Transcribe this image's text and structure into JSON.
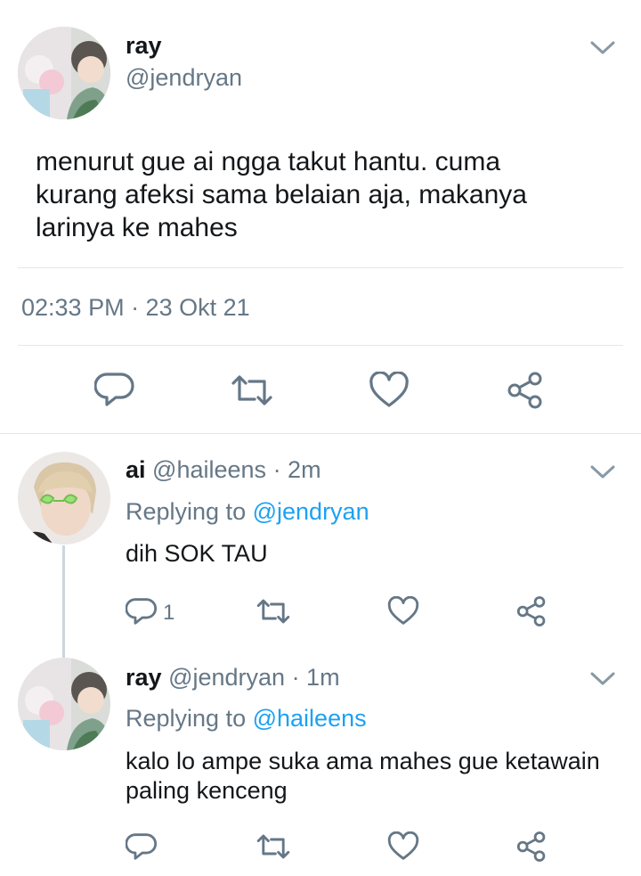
{
  "main_tweet": {
    "name": "ray",
    "handle": "@jendryan",
    "text_lines": [
      "menurut gue ai ngga takut hantu. cuma",
      "kurang afeksi sama belaian aja, makanya",
      "larinya ke mahes"
    ],
    "timestamp": "02:33 PM · 23 Okt 21"
  },
  "replies": [
    {
      "name": "ai",
      "handle": "@haileens",
      "age": "· 2m",
      "replying_prefix": "Replying to",
      "replying_to": "@jendryan",
      "text_lines": [
        "dih SOK TAU"
      ],
      "reply_count": "1"
    },
    {
      "name": "ray",
      "handle": "@jendryan",
      "age": "· 1m",
      "replying_prefix": "Replying to",
      "replying_to": "@haileens",
      "text_lines": [
        "kalo lo ampe suka ama mahes gue ketawain",
        "paling kenceng"
      ],
      "reply_count": ""
    }
  ],
  "colors": {
    "accent": "#1da1f2",
    "secondary_text": "#657786",
    "divider": "#e1e8ed",
    "icon_gray": "#657786"
  },
  "icons": [
    "chevron-down-icon",
    "reply-icon",
    "retweet-icon",
    "like-icon",
    "share-icon"
  ]
}
